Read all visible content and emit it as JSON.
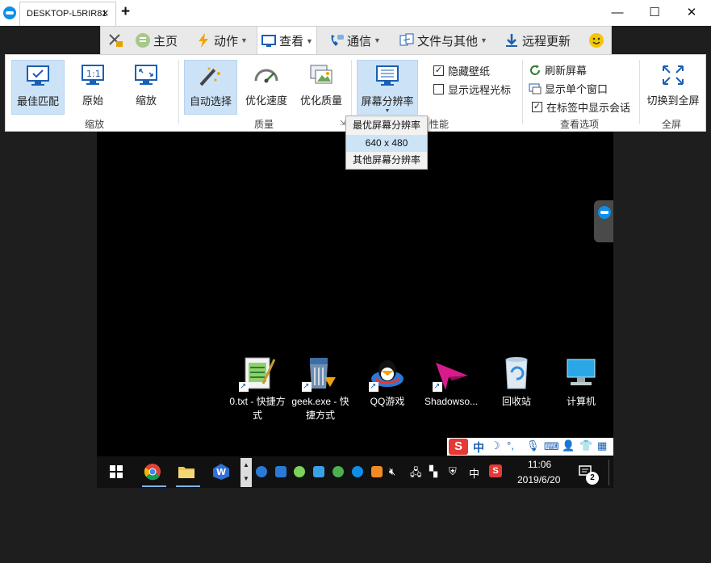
{
  "window": {
    "tab_title": "DESKTOP-L5RIR81",
    "tab_close": "×",
    "new_tab": "+",
    "minimize": "—",
    "maximize": "☐",
    "close": "✕"
  },
  "menubar": {
    "items": [
      {
        "label": "",
        "icon": "close-connection-icon"
      },
      {
        "label": "主页",
        "icon": "home-icon"
      },
      {
        "label": "动作",
        "icon": "lightning-icon",
        "has_dropdown": true
      },
      {
        "label": "查看",
        "icon": "view-icon",
        "has_dropdown": true,
        "active": true
      },
      {
        "label": "通信",
        "icon": "phone-icon",
        "has_dropdown": true
      },
      {
        "label": "文件与其他",
        "icon": "files-icon",
        "has_dropdown": true
      },
      {
        "label": "远程更新",
        "icon": "download-icon"
      },
      {
        "label": "",
        "icon": "smiley-icon"
      }
    ]
  },
  "ribbon": {
    "zoom_group": {
      "label": "缩放",
      "buttons": [
        {
          "label": "最佳匹配",
          "icon": "monitor-check-icon",
          "selected": true
        },
        {
          "label": "原始",
          "icon": "one-to-one-icon"
        },
        {
          "label": "缩放",
          "icon": "scale-icon"
        }
      ]
    },
    "quality_group": {
      "label": "质量",
      "buttons": [
        {
          "label": "自动选择",
          "icon": "magic-wand-icon",
          "selected": true
        },
        {
          "label": "优化速度",
          "icon": "speedometer-icon"
        },
        {
          "label": "优化质量",
          "icon": "picture-quality-icon"
        }
      ]
    },
    "performance_group": {
      "label": "性能",
      "resolution_button": "屏幕分辨率",
      "checks": [
        {
          "label": "隐藏壁纸",
          "checked": true
        },
        {
          "label": "显示远程光标",
          "checked": false
        }
      ]
    },
    "view_options_group": {
      "label": "查看选项",
      "items": [
        {
          "label": "刷新屏幕",
          "icon": "refresh-icon"
        },
        {
          "label": "显示单个窗口",
          "icon": "single-window-icon"
        },
        {
          "label": "在标签中显示会话",
          "checked": true
        }
      ]
    },
    "fullscreen_group": {
      "label": "全屏",
      "button": "切换到全屏"
    }
  },
  "resolution_dropdown": {
    "options": [
      "最优屏幕分辨率",
      "640 x 480",
      "其他屏幕分辨率"
    ],
    "highlighted_index": 1
  },
  "remote_desktop": {
    "icons": [
      {
        "label": "0.txt - 快捷方式",
        "icon": "notepad-icon"
      },
      {
        "label": "geek.exe - 快捷方式",
        "icon": "geek-uninstaller-icon"
      },
      {
        "label": "QQ游戏",
        "icon": "qq-game-icon"
      },
      {
        "label": "Shadowso...",
        "icon": "shadowsocks-icon"
      },
      {
        "label": "回收站",
        "icon": "recycle-bin-icon"
      },
      {
        "label": "计算机",
        "icon": "computer-icon"
      }
    ],
    "ime_bar": {
      "logo": "S",
      "mode": "中"
    },
    "taskbar": {
      "tray_lang": "中",
      "time": "11:06",
      "date": "2019/6/20",
      "notification_count": "2"
    }
  },
  "colors": {
    "accent": "#0e8ee9",
    "selected_bg": "#cce2f6",
    "remote_bg": "#000000",
    "outer_bg": "#1e1e1e"
  }
}
